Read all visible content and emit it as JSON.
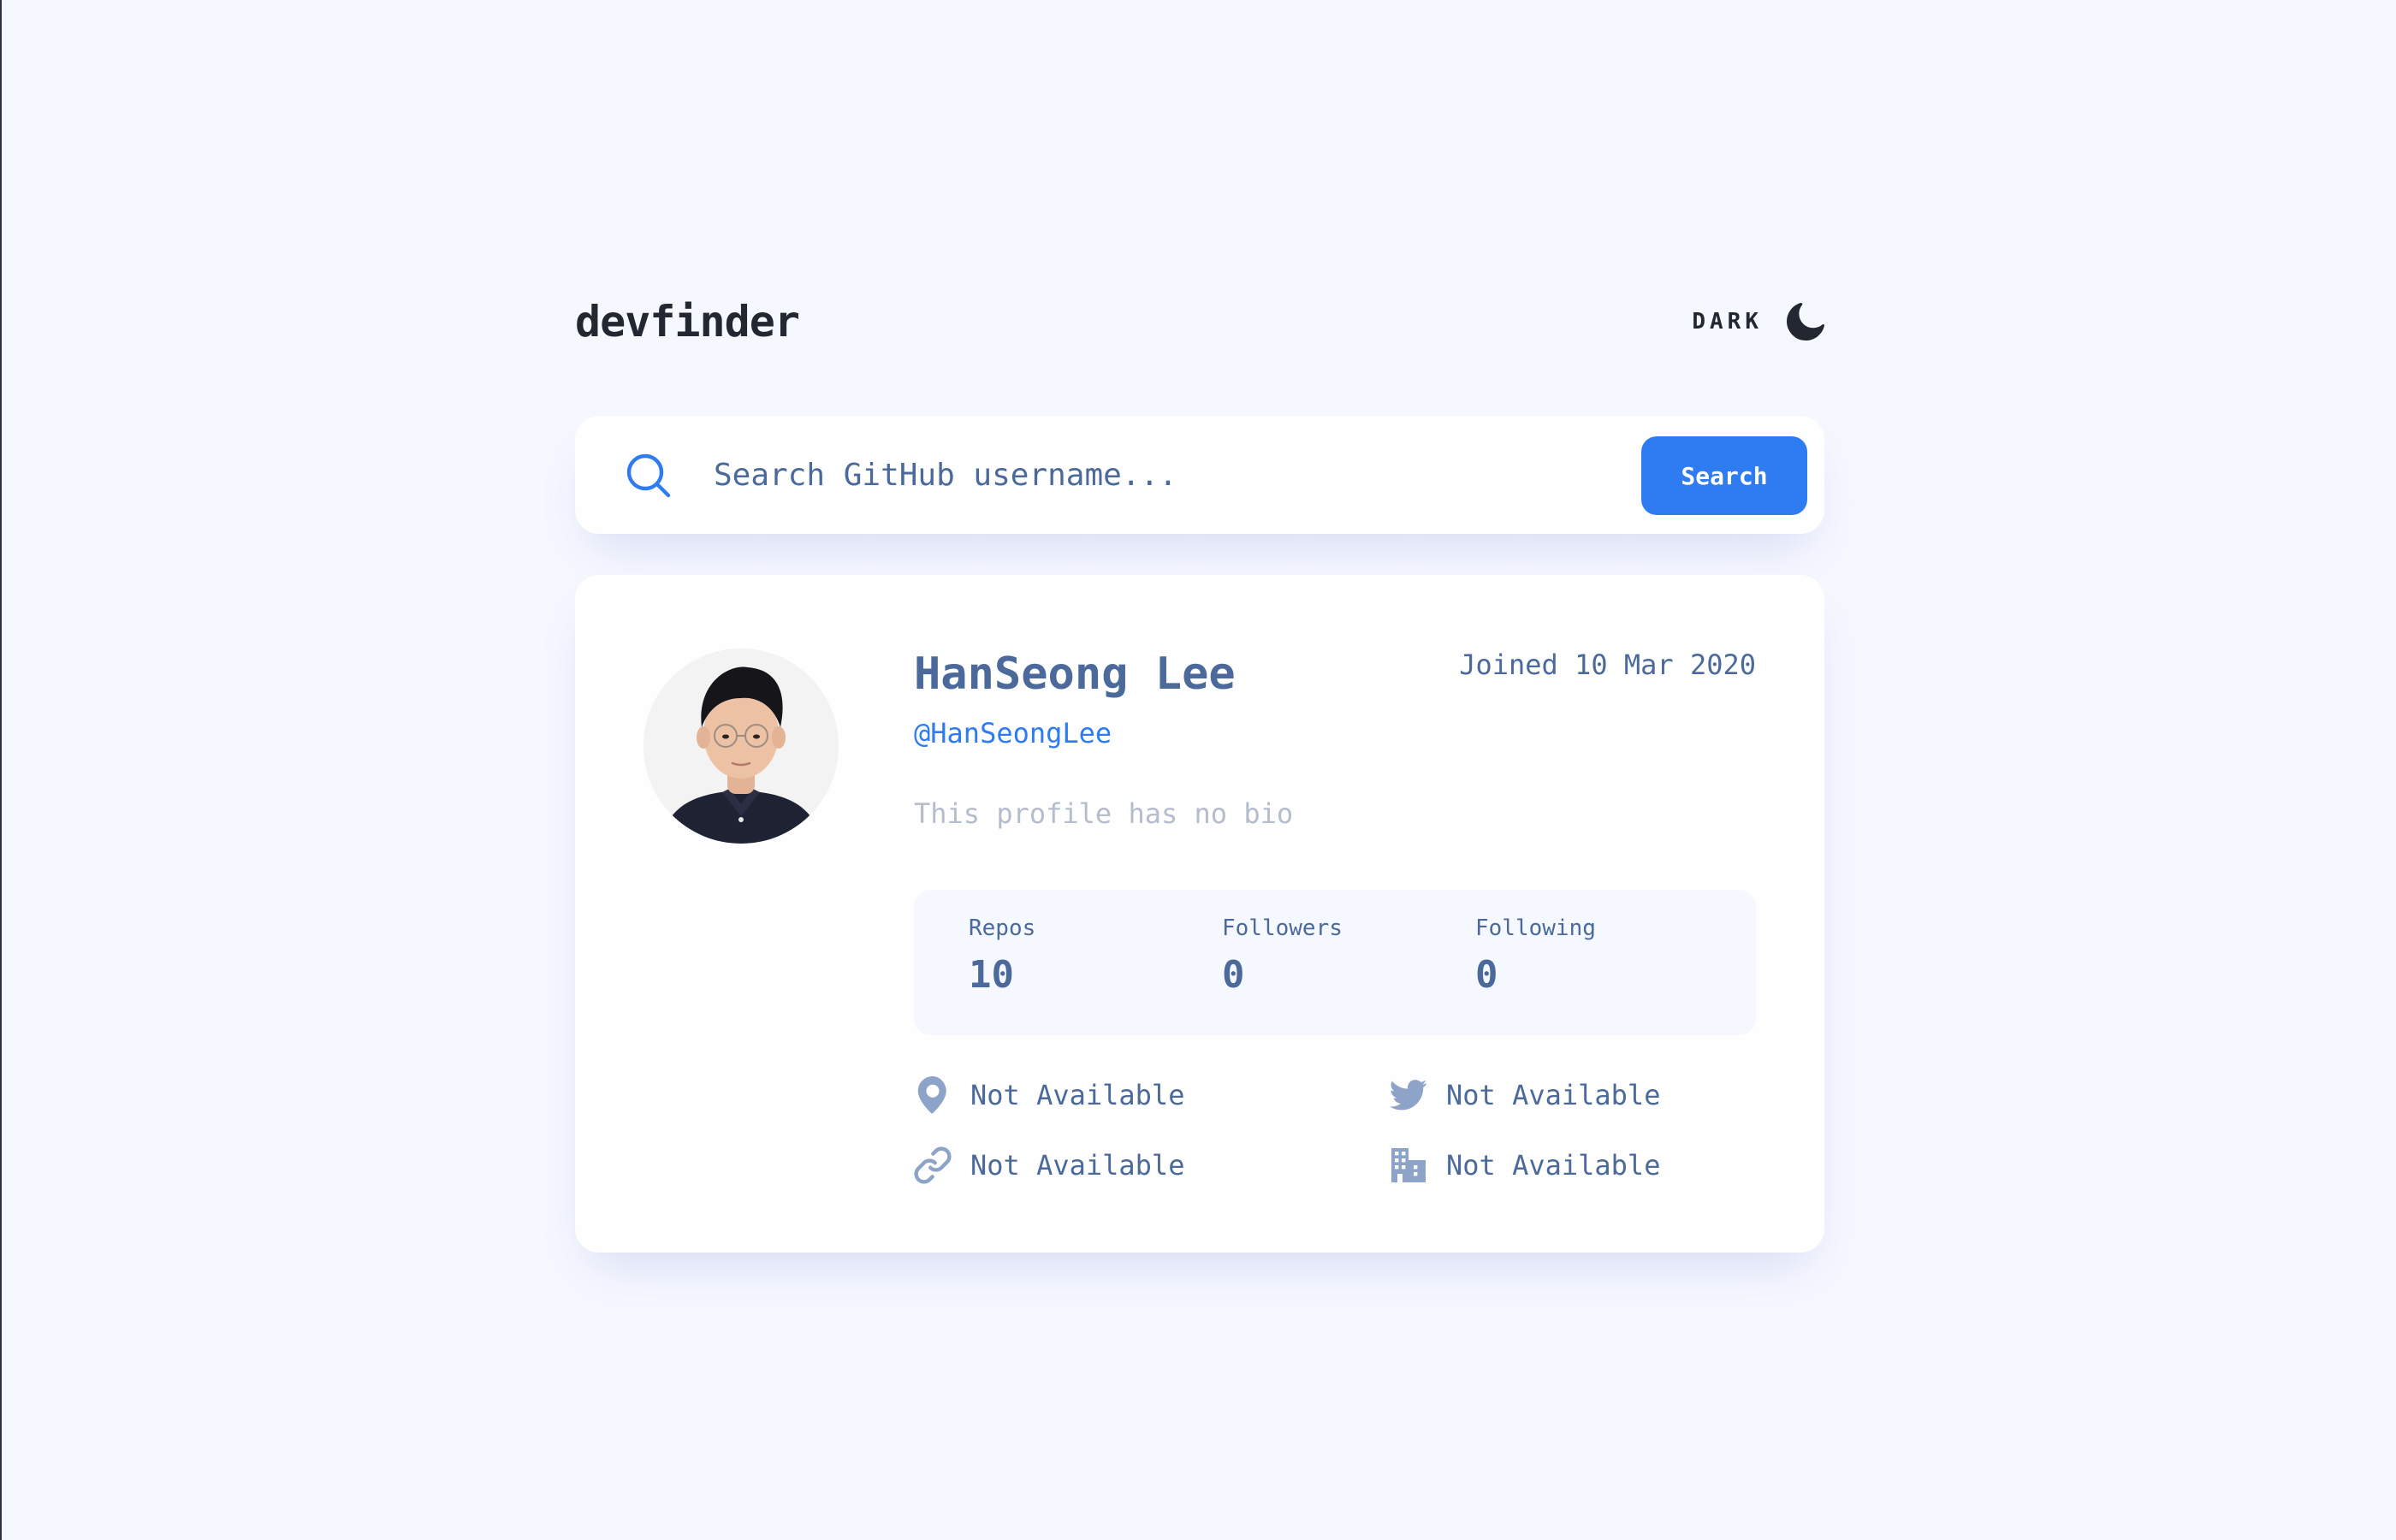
{
  "app": {
    "logo": "devfinder",
    "theme_toggle_label": "DARK"
  },
  "search": {
    "placeholder": "Search GitHub username...",
    "value": "",
    "button_label": "Search"
  },
  "profile": {
    "name": "HanSeong Lee",
    "login": "@HanSeongLee",
    "joined": "Joined 10 Mar 2020",
    "bio": "This profile has no bio",
    "stats": [
      {
        "label": "Repos",
        "value": "10"
      },
      {
        "label": "Followers",
        "value": "0"
      },
      {
        "label": "Following",
        "value": "0"
      }
    ],
    "links": {
      "location": "Not Available",
      "twitter": "Not Available",
      "blog": "Not Available",
      "company": "Not Available"
    }
  },
  "colors": {
    "accent": "#0079ff",
    "background": "#f6f8ff",
    "card": "#fefefe",
    "text_primary": "#4b6a9b",
    "text_muted": "#b5bdcc",
    "icon": "#8da4c8"
  },
  "icons": {
    "theme": "moon-icon",
    "search": "search-icon",
    "location": "location-pin-icon",
    "twitter": "twitter-icon",
    "blog": "link-icon",
    "company": "building-icon"
  }
}
